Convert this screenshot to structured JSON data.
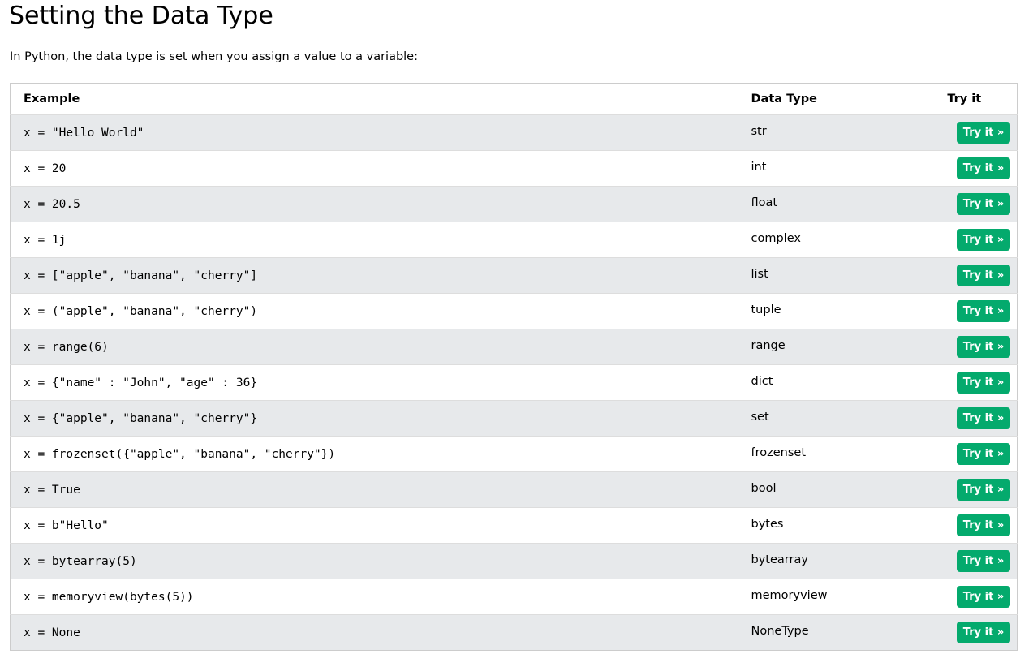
{
  "page": {
    "title": "Setting the Data Type",
    "intro": "In Python, the data type is set when you assign a value to a variable:"
  },
  "table": {
    "headers": {
      "example": "Example",
      "data_type": "Data Type",
      "try_it": "Try it"
    },
    "button_label": "Try it »",
    "rows": [
      {
        "example": "x = \"Hello World\"",
        "type": "str"
      },
      {
        "example": "x = 20",
        "type": "int"
      },
      {
        "example": "x = 20.5",
        "type": "float"
      },
      {
        "example": "x = 1j",
        "type": "complex"
      },
      {
        "example": "x = [\"apple\", \"banana\", \"cherry\"]",
        "type": "list"
      },
      {
        "example": "x = (\"apple\", \"banana\", \"cherry\")",
        "type": "tuple"
      },
      {
        "example": "x = range(6)",
        "type": "range"
      },
      {
        "example": "x = {\"name\" : \"John\", \"age\" : 36}",
        "type": "dict"
      },
      {
        "example": "x = {\"apple\", \"banana\", \"cherry\"}",
        "type": "set"
      },
      {
        "example": "x = frozenset({\"apple\", \"banana\", \"cherry\"})",
        "type": "frozenset"
      },
      {
        "example": "x = True",
        "type": "bool"
      },
      {
        "example": "x = b\"Hello\"",
        "type": "bytes"
      },
      {
        "example": "x = bytearray(5)",
        "type": "bytearray"
      },
      {
        "example": "x = memoryview(bytes(5))",
        "type": "memoryview"
      },
      {
        "example": "x = None",
        "type": "NoneType"
      }
    ]
  },
  "colors": {
    "button_bg": "#04aa6d",
    "button_text": "#ffffff",
    "row_stripe": "#e7e9eb",
    "border": "#cccccc"
  }
}
